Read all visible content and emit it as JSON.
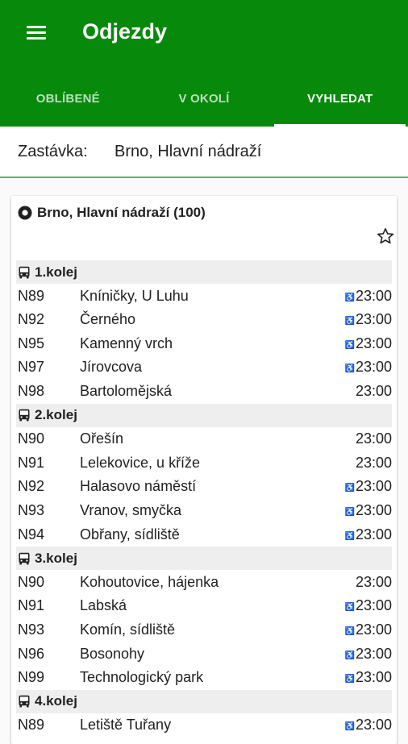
{
  "app": {
    "title": "Odjezdy"
  },
  "tabs": [
    {
      "label": "OBLÍBENÉ",
      "active": false
    },
    {
      "label": "V OKOLÍ",
      "active": false
    },
    {
      "label": "VYHLEDAT",
      "active": true
    }
  ],
  "search": {
    "label": "Zastávka:",
    "value": "Brno, Hlavní nádraží"
  },
  "stop": {
    "title": "Brno, Hlavní nádraží (100)"
  },
  "colors": {
    "appbar": "#078a0c",
    "accent_underline": "#4cbf4f"
  },
  "groups": [
    {
      "name": "1.kolej",
      "rows": [
        {
          "line": "N89",
          "destination": "Kníničky, U Luhu",
          "time": "23:00",
          "accessible": true
        },
        {
          "line": "N92",
          "destination": "Černého",
          "time": "23:00",
          "accessible": true
        },
        {
          "line": "N95",
          "destination": "Kamenný vrch",
          "time": "23:00",
          "accessible": true
        },
        {
          "line": "N97",
          "destination": "Jírovcova",
          "time": "23:00",
          "accessible": true
        },
        {
          "line": "N98",
          "destination": "Bartolomějská",
          "time": "23:00",
          "accessible": false
        }
      ]
    },
    {
      "name": "2.kolej",
      "rows": [
        {
          "line": "N90",
          "destination": "Ořešín",
          "time": "23:00",
          "accessible": false
        },
        {
          "line": "N91",
          "destination": "Lelekovice, u kříže",
          "time": "23:00",
          "accessible": false
        },
        {
          "line": "N92",
          "destination": "Halasovo náměstí",
          "time": "23:00",
          "accessible": true
        },
        {
          "line": "N93",
          "destination": "Vranov, smyčka",
          "time": "23:00",
          "accessible": true
        },
        {
          "line": "N94",
          "destination": "Obřany, sídliště",
          "time": "23:00",
          "accessible": true
        }
      ]
    },
    {
      "name": "3.kolej",
      "rows": [
        {
          "line": "N90",
          "destination": "Kohoutovice, hájenka",
          "time": "23:00",
          "accessible": false
        },
        {
          "line": "N91",
          "destination": "Labská",
          "time": "23:00",
          "accessible": true
        },
        {
          "line": "N93",
          "destination": "Komín, sídliště",
          "time": "23:00",
          "accessible": true
        },
        {
          "line": "N96",
          "destination": "Bosonohy",
          "time": "23:00",
          "accessible": true
        },
        {
          "line": "N99",
          "destination": "Technologický park",
          "time": "23:00",
          "accessible": true
        }
      ]
    },
    {
      "name": "4.kolej",
      "rows": [
        {
          "line": "N89",
          "destination": "Letiště Tuřany",
          "time": "23:00",
          "accessible": true
        }
      ]
    }
  ]
}
